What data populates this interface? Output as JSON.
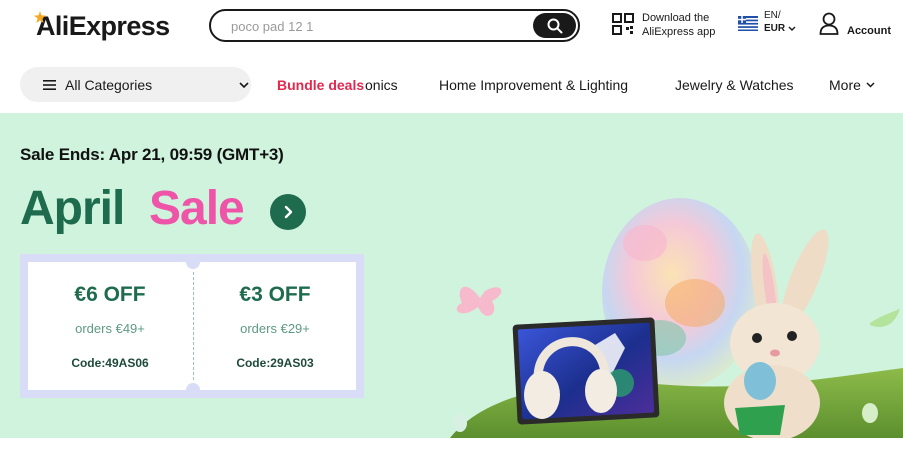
{
  "header": {
    "logo": "AliExpress",
    "search": {
      "value": "",
      "placeholder": "poco pad 12 1"
    },
    "download": {
      "line1": "Download the",
      "line2": "AliExpress app"
    },
    "locale": {
      "language": "EN/",
      "currency": "EUR"
    },
    "account_label": "Account"
  },
  "nav": {
    "all_categories": "All Categories",
    "items": [
      {
        "label": "Bundle deals"
      },
      {
        "label": "onics"
      },
      {
        "label": "Home Improvement & Lighting"
      },
      {
        "label": "Jewelry & Watches"
      },
      {
        "label": "More"
      }
    ]
  },
  "banner": {
    "sale_ends": "Sale Ends: Apr 21, 09:59 (GMT+3)",
    "title_part1": "April",
    "title_part2": "Sale",
    "coupons": [
      {
        "amount": "€6 OFF",
        "condition": "orders €49+",
        "code": "Code:49AS06"
      },
      {
        "amount": "€3 OFF",
        "condition": "orders €29+",
        "code": "Code:29AS03"
      }
    ]
  },
  "icons": [
    "search-icon",
    "qr-code-icon",
    "greece-flag-icon",
    "chevron-down-icon",
    "user-icon",
    "menu-icon",
    "arrow-right-icon"
  ],
  "colors": {
    "brand_dark": "#191919",
    "bundle_red": "#e1284f",
    "banner_bg": "#cff3dd",
    "title_green": "#1e6b4d",
    "title_pink": "#ee55a8",
    "coupon_frame": "#d8dcf6"
  }
}
